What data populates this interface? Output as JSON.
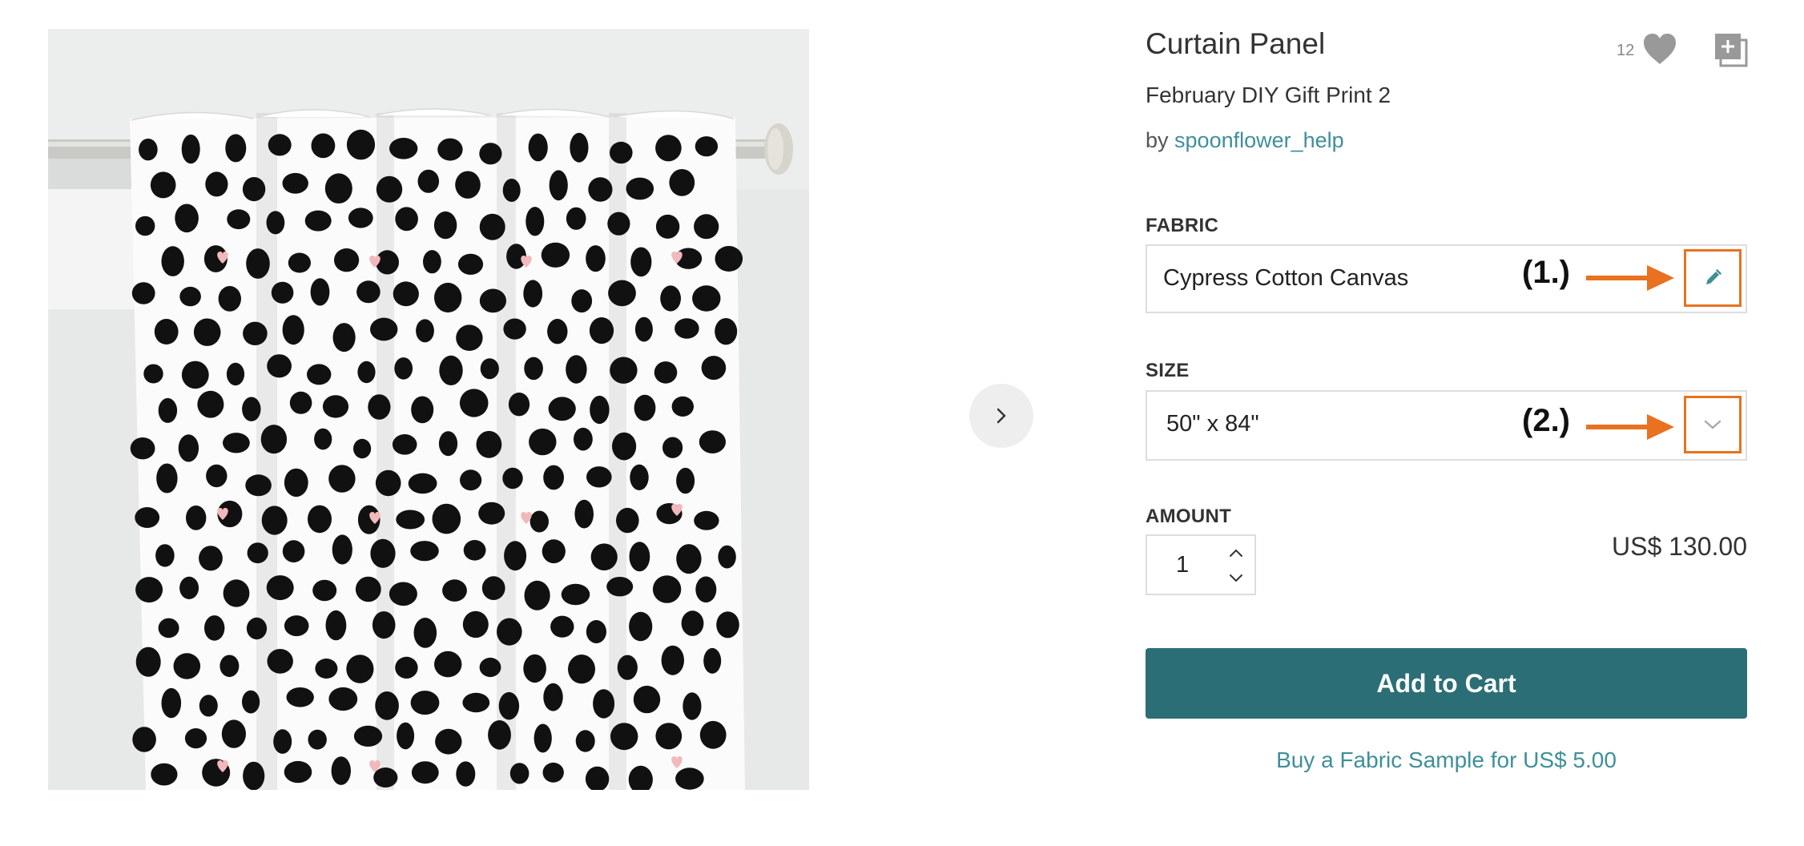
{
  "product": {
    "type": "Curtain Panel",
    "design_title": "February DIY Gift Print 2",
    "designer_prefix": "by ",
    "designer_name": "spoonflower_help",
    "favorite_count": "12"
  },
  "gallery": {
    "next_icon": "chevron-right-icon"
  },
  "fabric": {
    "label": "FABRIC",
    "value": "Cypress Cotton Canvas",
    "step_label": "(1.)",
    "edit_icon": "pencil-icon"
  },
  "size": {
    "label": "SIZE",
    "value": "50\" x 84\"",
    "step_label": "(2.)",
    "dropdown_icon": "chevron-down-icon"
  },
  "amount": {
    "label": "AMOUNT",
    "quantity": "1"
  },
  "price": "US$ 130.00",
  "cart": {
    "add_label": "Add to Cart",
    "sample_label": "Buy a Fabric Sample for US$ 5.00"
  },
  "colors": {
    "accent_teal": "#2c6e76",
    "link_teal": "#3f8f99",
    "annotation_orange": "#e8721f"
  }
}
